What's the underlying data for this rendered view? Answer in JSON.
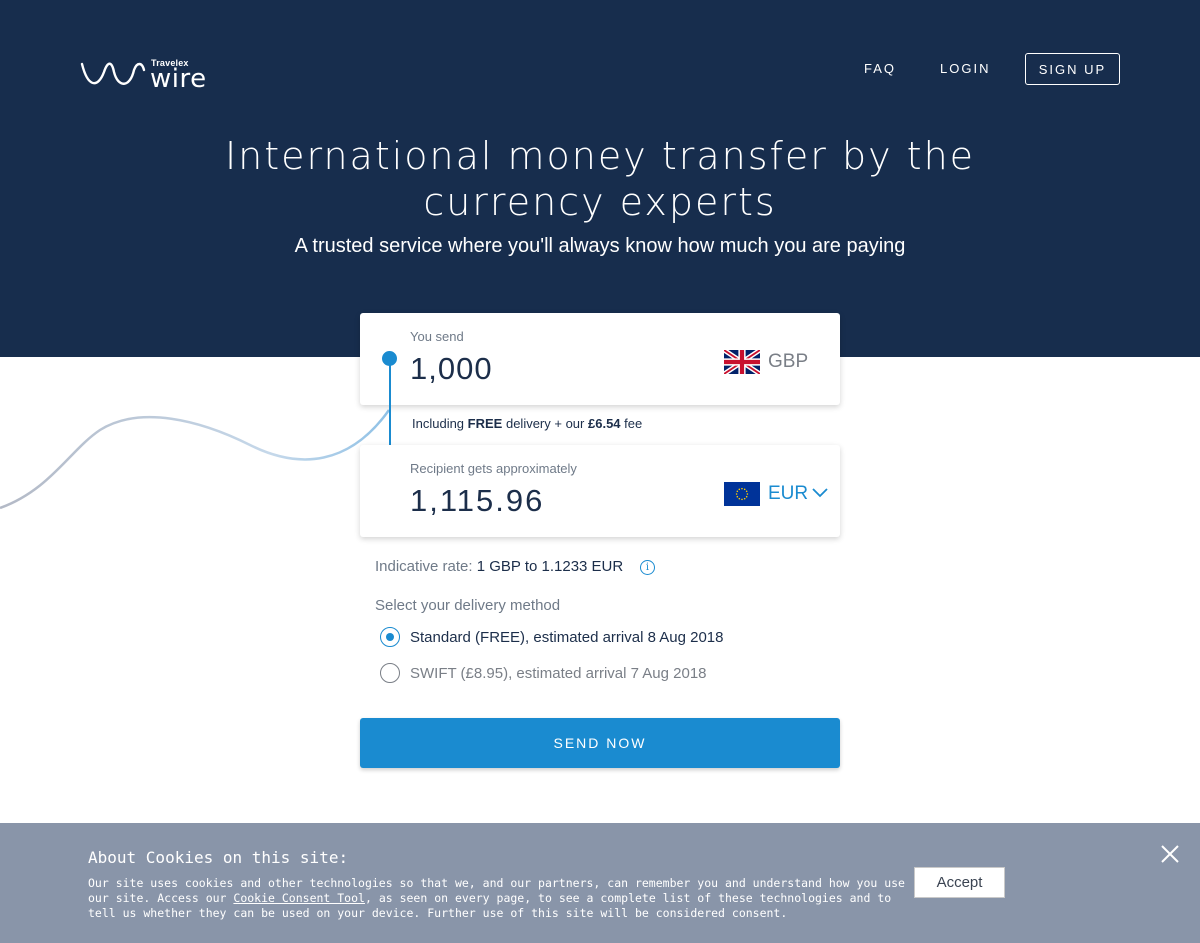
{
  "header": {
    "brand_small": "Travelex",
    "brand_word": "wire",
    "nav": {
      "faq": "FAQ",
      "login": "LOGIN",
      "signup": "SIGN UP"
    }
  },
  "hero": {
    "headline_line1": "International money transfer by the",
    "headline_line2": "currency experts",
    "subhead": "A trusted service where you'll always know how much you are paying"
  },
  "converter": {
    "send": {
      "label": "You send",
      "amount": "1,000",
      "currency": "GBP",
      "flag_icon": "uk-flag-icon"
    },
    "fee": {
      "prefix": "Including",
      "free": "FREE",
      "middle": "delivery + our",
      "amount": "£6.54",
      "suffix": "fee"
    },
    "receive": {
      "label": "Recipient gets approximately",
      "amount": "1,115.96",
      "currency": "EUR",
      "flag_icon": "eu-flag-icon"
    },
    "rate": {
      "label": "Indicative rate:",
      "value": "1 GBP to 1.1233 EUR"
    }
  },
  "delivery": {
    "title": "Select your delivery method",
    "options": [
      {
        "label": "Standard (FREE), estimated arrival 8 Aug 2018",
        "selected": true
      },
      {
        "label": "SWIFT (£8.95), estimated arrival 7 Aug 2018",
        "selected": false
      }
    ]
  },
  "cta": {
    "label": "SEND NOW"
  },
  "cookie_banner": {
    "title": "About Cookies on this site:",
    "text_1": "Our site uses cookies and other technologies so that we, and our partners, can remember you and understand how you use our site. Access our ",
    "link": "Cookie Consent Tool",
    "text_2": ", as seen on every page, to see a complete list of these technologies and to tell us whether they can be used on your device. Further use of this site will be considered consent.",
    "accept": "Accept"
  },
  "colors": {
    "navy": "#172d4d",
    "accent_blue": "#1a8bd0",
    "cookie_bg": "#8995a9"
  }
}
